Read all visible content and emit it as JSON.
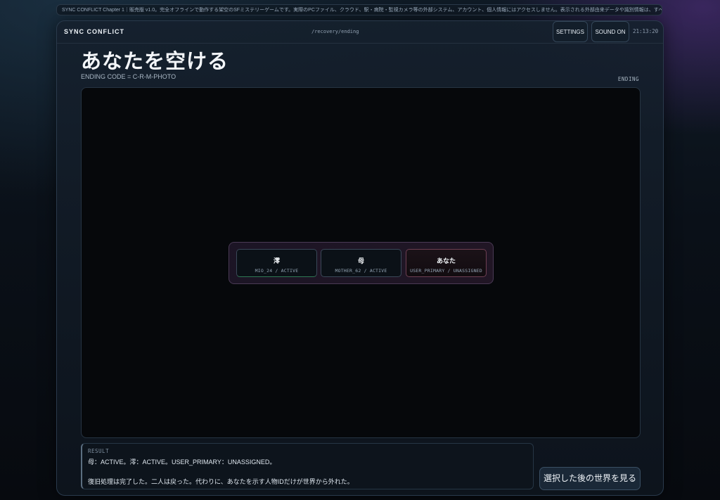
{
  "notice": "SYNC CONFLICT Chapter 1｜販売版 v1.0。完全オフラインで動作する架空のSFミステリーゲームです。実際のPCファイル、クラウド、駅・病院・監視カメラ等の外部システム、アカウント、個人情報にはアクセスしません。表示される外部由来データや識別情報は、すべて物語上の演出です。",
  "titlebar": {
    "app_name": "SYNC CONFLICT",
    "path": "/recovery/ending",
    "settings_label": "SETTINGS",
    "sound_label": "SOUND ON",
    "clock": "21:13:20"
  },
  "main": {
    "heading": "あなたを空ける",
    "ending_code": "ENDING CODE = C-R-M-PHOTO",
    "ending_label": "ENDING"
  },
  "cards": [
    {
      "name": "澪",
      "status": "MIO_24 / ACTIVE"
    },
    {
      "name": "母",
      "status": "MOTHER_62 / ACTIVE"
    },
    {
      "name": "あなた",
      "status": "USER_PRIMARY / UNASSIGNED"
    }
  ],
  "result": {
    "label": "RESULT",
    "line1": "母：ACTIVE。澪：ACTIVE。USER_PRIMARY：UNASSIGNED。",
    "line2": "復旧処理は完了した。二人は戻った。代わりに、あなたを示す人物IDだけが世界から外れた。"
  },
  "cta_label": "選択した後の世界を見る",
  "colors": {
    "background": "#0a1018",
    "accent_active": "#2f7a55",
    "accent_unassigned": "#6d3f52"
  }
}
